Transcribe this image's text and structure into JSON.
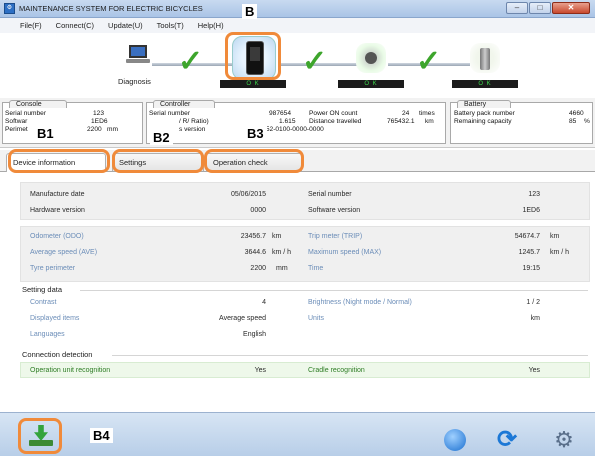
{
  "window": {
    "title": "MAINTENANCE SYSTEM FOR ELECTRIC BICYCLES",
    "app_icon": "app-icon",
    "buttons": [
      "minimize",
      "maximize",
      "close"
    ]
  },
  "menu": {
    "items": [
      "File(F)",
      "Connect(C)",
      "Update(U)",
      "Tools(T)",
      "Help(H)"
    ]
  },
  "flow": {
    "diagnosis_label": "Diagnosis",
    "ok_text": "O K",
    "devices": [
      "laptop-icon",
      "console-icon",
      "motor-icon",
      "battery-icon"
    ],
    "check_icon": "checkmark-icon"
  },
  "panels": {
    "console": {
      "title": "Console",
      "rows": [
        {
          "label": "Serial number",
          "value": "123",
          "unit": ""
        },
        {
          "label": "Softwar",
          "value": "1ED6",
          "unit": ""
        },
        {
          "label": "Perimet",
          "value": "2200",
          "unit": "mm"
        }
      ]
    },
    "controller": {
      "title": "Controller",
      "rows": [
        {
          "label": "Serial number",
          "value": "987654"
        },
        {
          "label": "/ R/ Ratio)",
          "value": "1.615"
        },
        {
          "label": "s version",
          "value": "01-8252-0100-0000-0000"
        }
      ],
      "stats": [
        {
          "label": "Power ON count",
          "value": "24",
          "unit": "times"
        },
        {
          "label": "Distance travelled",
          "value": "765432.1",
          "unit": "km"
        }
      ]
    },
    "battery": {
      "title": "Battery",
      "rows": [
        {
          "label": "Battery pack number",
          "value": "4660",
          "unit": ""
        },
        {
          "label": "Remaining capacity",
          "value": "85",
          "unit": "%"
        }
      ]
    }
  },
  "callouts": {
    "b": "B",
    "b1": "B1",
    "b2": "B2",
    "b3": "B3",
    "b4": "B4"
  },
  "tabs": [
    "Device information",
    "Settings",
    "Operation check"
  ],
  "device_info": {
    "manufacture_date_label": "Manufacture date",
    "manufacture_date": "05/06/2015",
    "serial_number_label": "Serial number",
    "serial_number": "123",
    "hardware_version_label": "Hardware version",
    "hardware_version": "0000",
    "software_version_label": "Software version",
    "software_version": "1ED6"
  },
  "ride": {
    "odometer_label": "Odometer (ODO)",
    "odometer": "23456.7",
    "odometer_unit": "km",
    "trip_label": "Trip meter (TRIP)",
    "trip": "54674.7",
    "trip_unit": "km",
    "avg_label": "Average speed (AVE)",
    "avg": "3644.6",
    "avg_unit": "km / h",
    "max_label": "Maximum speed (MAX)",
    "max": "1245.7",
    "max_unit": "km / h",
    "tyre_label": "Tyre perimeter",
    "tyre": "2200",
    "tyre_unit": "mm",
    "time_label": "Time",
    "time": "19:15"
  },
  "setting_data": {
    "title": "Setting data",
    "contrast_label": "Contrast",
    "contrast": "4",
    "brightness_label": "Brightness (Night mode / Normal)",
    "brightness": "1 / 2",
    "displayed_label": "Displayed items",
    "displayed": "Average speed",
    "units_label": "Units",
    "units": "km",
    "languages_label": "Languages",
    "languages": "English"
  },
  "connection": {
    "title": "Connection detection",
    "operation_label": "Operation unit recognition",
    "operation": "Yes",
    "cradle_label": "Cradle recognition",
    "cradle": "Yes"
  },
  "bottom": {
    "icons": [
      "download-icon",
      "globe-icon",
      "sync-icon",
      "gear-icon"
    ]
  },
  "colors": {
    "callout": "#f08a3a",
    "ok_green": "#3bd64b",
    "check_green": "#3da52c",
    "blue_label": "#6b8db8"
  }
}
